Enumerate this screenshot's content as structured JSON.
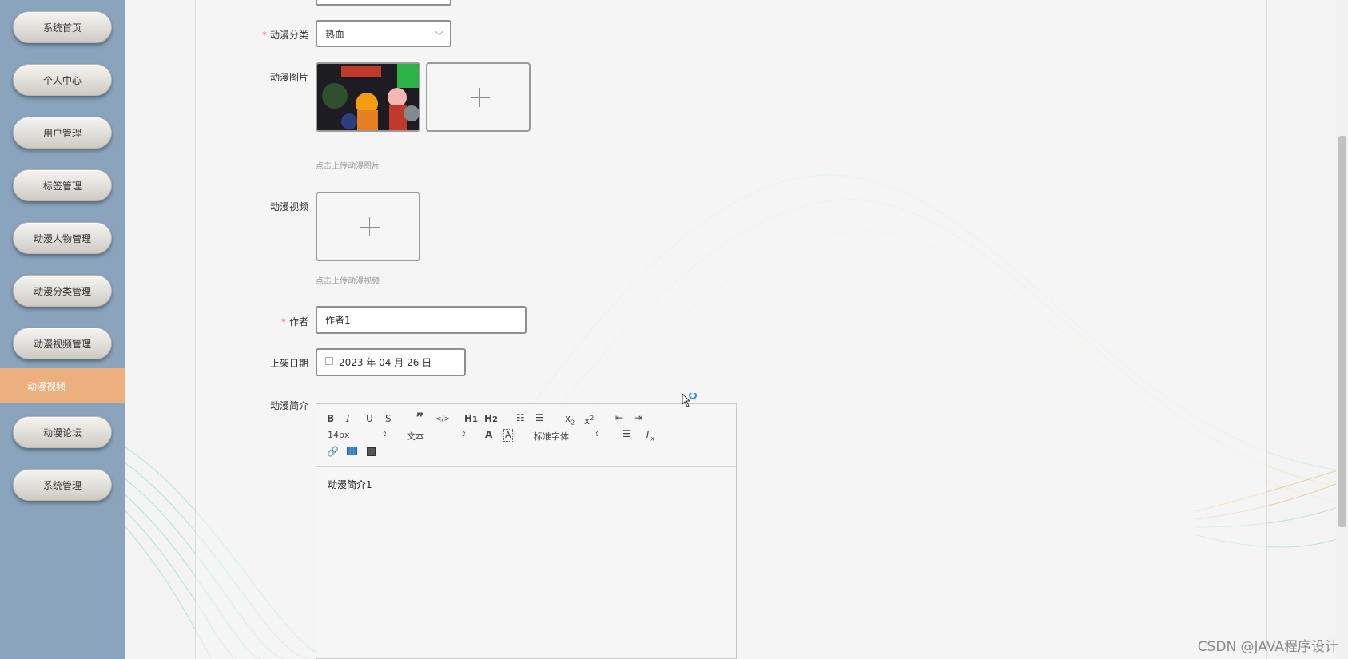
{
  "sidebar": {
    "items": [
      {
        "label": "系统首页"
      },
      {
        "label": "个人中心"
      },
      {
        "label": "用户管理"
      },
      {
        "label": "标签管理"
      },
      {
        "label": "动漫人物管理"
      },
      {
        "label": "动漫分类管理"
      },
      {
        "label": "动漫视频管理"
      },
      {
        "label": "动漫视频",
        "active": true
      },
      {
        "label": "动漫论坛"
      },
      {
        "label": "系统管理"
      }
    ]
  },
  "form": {
    "category_label": "动漫分类",
    "category_value": "热血",
    "image_label": "动漫图片",
    "image_hint": "点击上传动漫图片",
    "video_label": "动漫视频",
    "video_hint": "点击上传动漫视频",
    "author_label": "作者",
    "author_value": "作者1",
    "date_label": "上架日期",
    "date_value": "2023 年 04 月 26 日",
    "intro_label": "动漫简介",
    "intro_value": "动漫简介1"
  },
  "editor": {
    "font_size": "14px",
    "text_type": "文本",
    "font_family": "标准字体"
  },
  "watermark": "CSDN @JAVA程序设计",
  "colors": {
    "sidebar_bg": "#8aa4be",
    "active_item": "#ebb07e",
    "required": "#f56c6c"
  }
}
